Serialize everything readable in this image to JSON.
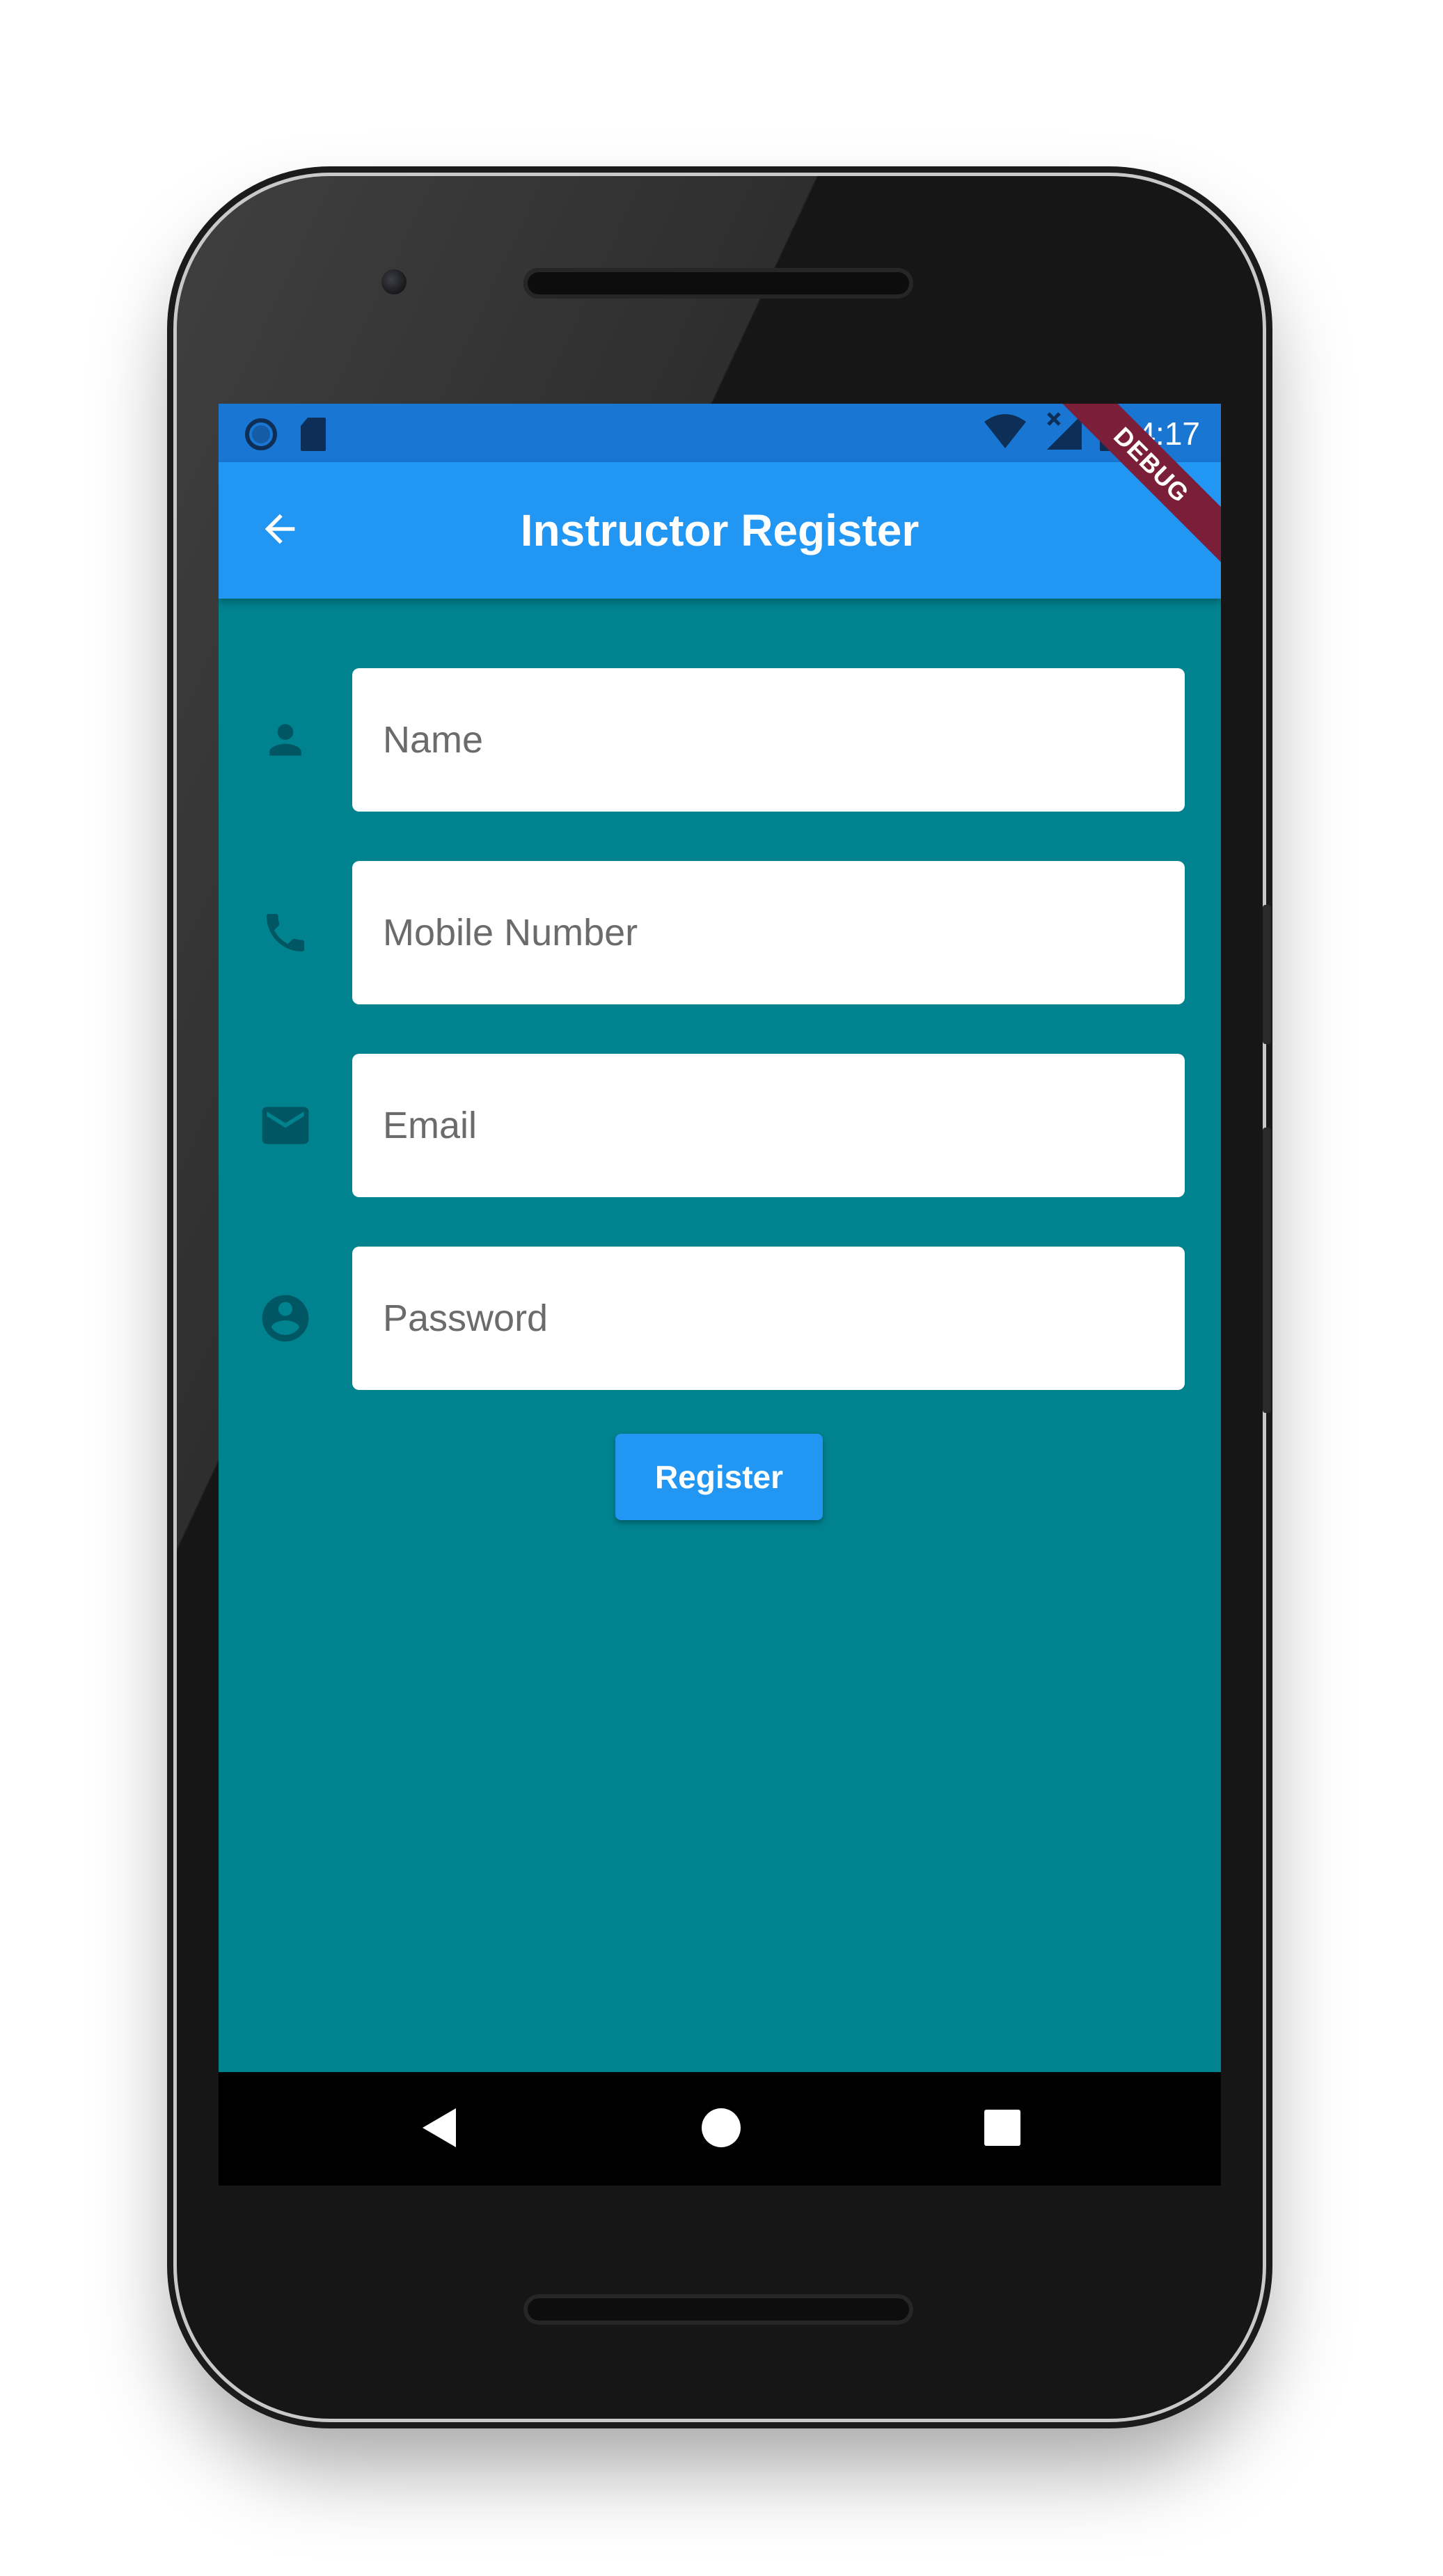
{
  "status_bar": {
    "time": "4:17",
    "icons": [
      "circle-notification-icon",
      "sd-card-icon",
      "wifi-icon",
      "cell-signal-no-data-icon",
      "battery-icon"
    ]
  },
  "app_bar": {
    "title": "Instructor Register",
    "back_icon": "arrow-back-icon"
  },
  "debug_banner": "DEBUG",
  "form": {
    "fields": [
      {
        "icon": "person-icon",
        "placeholder": "Name",
        "value": ""
      },
      {
        "icon": "phone-icon",
        "placeholder": "Mobile Number",
        "value": ""
      },
      {
        "icon": "email-icon",
        "placeholder": "Email",
        "value": ""
      },
      {
        "icon": "account-circle-icon",
        "placeholder": "Password",
        "value": ""
      }
    ],
    "submit_label": "Register"
  },
  "nav_bar": {
    "icons": [
      "nav-back-icon",
      "nav-home-icon",
      "nav-recents-icon"
    ]
  },
  "colors": {
    "screen_background": "#00838f",
    "app_bar": "#2196f3",
    "status_bar": "#1976d2",
    "button": "#2196f3",
    "icon": "#005662",
    "debug_banner": "#7b1e3a"
  }
}
